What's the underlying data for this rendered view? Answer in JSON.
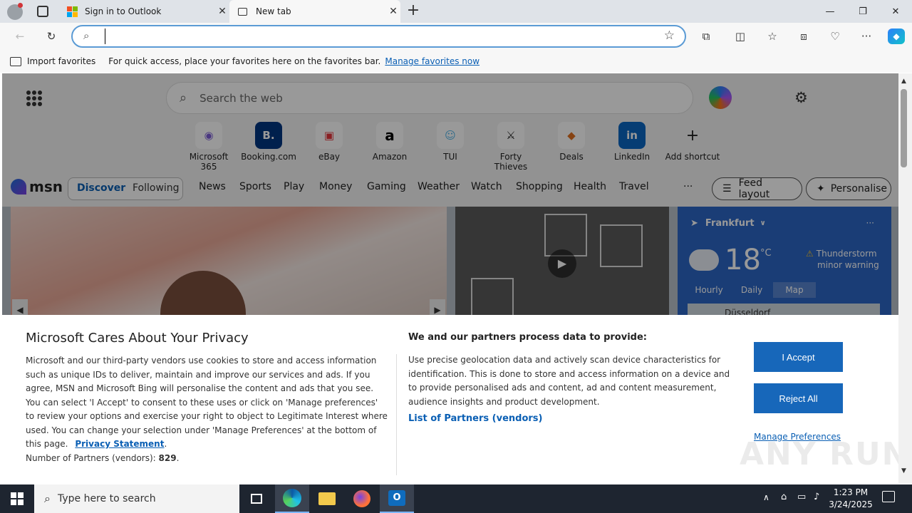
{
  "browser": {
    "tabs": [
      {
        "title": "Sign in to Outlook"
      },
      {
        "title": "New tab"
      }
    ],
    "address": {
      "value": "",
      "placeholder": ""
    }
  },
  "favorites_bar": {
    "import_label": "Import favorites",
    "message": "For quick access, place your favorites here on the favorites bar.",
    "manage_link": "Manage favorites now"
  },
  "newtab": {
    "search_placeholder": "Search the web",
    "shortcuts": [
      {
        "label": "Microsoft 365"
      },
      {
        "label": "Booking.com"
      },
      {
        "label": "eBay"
      },
      {
        "label": "Amazon"
      },
      {
        "label": "TUI"
      },
      {
        "label": "Forty Thieves"
      },
      {
        "label": "Deals"
      },
      {
        "label": "LinkedIn"
      },
      {
        "label": "Add shortcut"
      }
    ],
    "msn": {
      "logo": "msn",
      "tabs": [
        "Discover",
        "Following"
      ],
      "nav": [
        "News",
        "Sports",
        "Play",
        "Money",
        "Gaming",
        "Weather",
        "Watch",
        "Shopping",
        "Health",
        "Travel"
      ],
      "more": "···",
      "feed_layout": "Feed layout",
      "personalise": "Personalise"
    },
    "weather": {
      "city": "Frankfurt",
      "temp": "18",
      "unit": "°C",
      "alert_line1": "Thunderstorm",
      "alert_line2": "minor warning",
      "tabs": [
        "Hourly",
        "Daily",
        "Map"
      ],
      "map_label": "Düsseldorf"
    }
  },
  "privacy": {
    "title": "Microsoft Cares About Your Privacy",
    "body": "Microsoft and our third-party vendors use cookies to store and access information such as unique IDs to deliver, maintain and improve our services and ads. If you agree, MSN and Microsoft Bing will personalise the content and ads that you see. You can select 'I Accept' to consent to these uses or click on 'Manage preferences' to review your options and exercise your right to object to Legitimate Interest where used.  You can change your selection under 'Manage Preferences' at the bottom of this page.",
    "privacy_link": "Privacy Statement",
    "partners_label": "Number of Partners (vendors):",
    "partners_count": "829",
    "right_title": "We and our partners process data to provide:",
    "right_body": "Use precise geolocation data and actively scan device characteristics for identification. This is done to store and access information on a device and to provide personalised ads and content, ad and content measurement, audience insights and product development.",
    "partners_link": "List of Partners (vendors)",
    "accept": "I Accept",
    "reject": "Reject All",
    "manage": "Manage Preferences"
  },
  "taskbar": {
    "search_placeholder": "Type here to search",
    "time": "1:23 PM",
    "date": "3/24/2025"
  },
  "watermark": "ANY RUN"
}
